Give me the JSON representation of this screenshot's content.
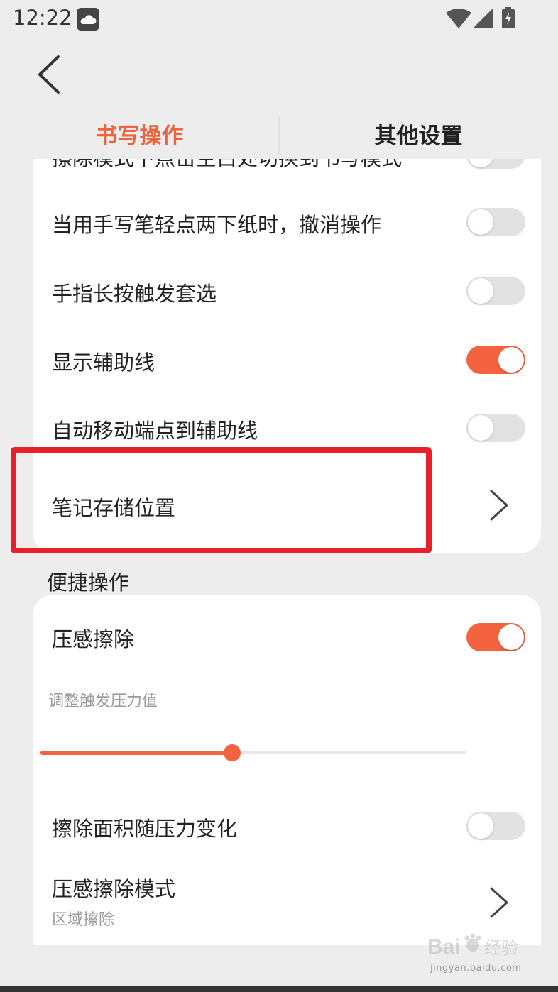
{
  "status_bar": {
    "time": "12:22"
  },
  "tabs": [
    {
      "label": "书写操作",
      "active": true
    },
    {
      "label": "其他设置",
      "active": false
    }
  ],
  "main_card": {
    "partial_row": {
      "label": "擦除模式下点击空白处切换到书写模式",
      "state": "off"
    },
    "rows": [
      {
        "label": "当用手写笔轻点两下纸时，撤消操作",
        "state": "off"
      },
      {
        "label": "手指长按触发套选",
        "state": "off"
      },
      {
        "label": "显示辅助线",
        "state": "on"
      },
      {
        "label": "自动移动端点到辅助线",
        "state": "off"
      }
    ],
    "nav_row": {
      "label": "笔记存储位置"
    }
  },
  "quick_section": {
    "header": "便捷操作",
    "pressure_erase": {
      "label": "压感擦除",
      "state": "on"
    },
    "slider": {
      "label": "调整触发压力值",
      "value": 0.45
    },
    "area_varies": {
      "label": "擦除面积随压力变化",
      "state": "off"
    },
    "mode_row": {
      "label": "压感擦除模式",
      "value": "区域擦除"
    }
  },
  "watermark": {
    "brand": "Bai 经验",
    "url": "jingyan.baidu.com"
  },
  "colors": {
    "accent": "#f4623f",
    "highlight": "#e8202a",
    "background": "#ededed"
  },
  "icons": [
    "weather-cloud-icon",
    "wifi-icon",
    "signal-icon",
    "battery-charging-icon",
    "back-arrow-icon",
    "chevron-right-icon"
  ]
}
